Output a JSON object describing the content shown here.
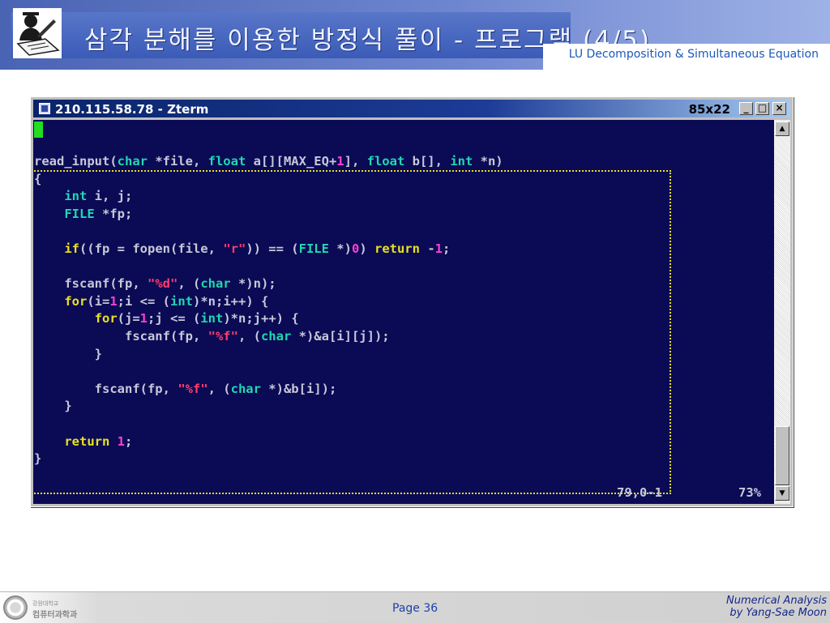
{
  "slide": {
    "title": "삼각 분해를 이용한 방정식 풀이 - 프로그램 (4/5)",
    "subtitle": "LU Decomposition & Simultaneous Equation"
  },
  "terminal": {
    "title": "210.115.58.78 - Zterm",
    "size_label": "85x22",
    "min_glyph": "_",
    "max_glyph": "□",
    "close_glyph": "×",
    "status_position": "79,0-1",
    "status_percent": "73%",
    "scroll_up": "▲",
    "scroll_down": "▼",
    "code_lines": [
      [
        [
          "read_input(",
          ""
        ],
        [
          "char",
          "ty"
        ],
        [
          " *file, ",
          ""
        ],
        [
          "float",
          "ty"
        ],
        [
          " a[][MAX_EQ+",
          ""
        ],
        [
          "1",
          "num"
        ],
        [
          "], ",
          ""
        ],
        [
          "float",
          "ty"
        ],
        [
          " b[], ",
          ""
        ],
        [
          "int",
          "ty"
        ],
        [
          " *n)",
          ""
        ]
      ],
      [
        [
          "{",
          ""
        ]
      ],
      [
        [
          "    ",
          ""
        ],
        [
          "int",
          "ty"
        ],
        [
          " i, j;",
          ""
        ]
      ],
      [
        [
          "    ",
          ""
        ],
        [
          "FILE",
          "ty"
        ],
        [
          " *fp;",
          ""
        ]
      ],
      [
        [
          "",
          ""
        ]
      ],
      [
        [
          "    ",
          ""
        ],
        [
          "if",
          "kw"
        ],
        [
          "((fp = fopen(file, ",
          ""
        ],
        [
          "\"r\"",
          "str"
        ],
        [
          ")) == (",
          ""
        ],
        [
          "FILE",
          "ty"
        ],
        [
          " *)",
          ""
        ],
        [
          "0",
          "num"
        ],
        [
          ") ",
          ""
        ],
        [
          "return",
          "kw"
        ],
        [
          " -",
          ""
        ],
        [
          "1",
          "num"
        ],
        [
          ";",
          ""
        ]
      ],
      [
        [
          "",
          ""
        ]
      ],
      [
        [
          "    fscanf(fp, ",
          ""
        ],
        [
          "\"%d\"",
          "str"
        ],
        [
          ", (",
          ""
        ],
        [
          "char",
          "ty"
        ],
        [
          " *)n);",
          ""
        ]
      ],
      [
        [
          "    ",
          ""
        ],
        [
          "for",
          "kw"
        ],
        [
          "(i=",
          ""
        ],
        [
          "1",
          "num"
        ],
        [
          ";i <= (",
          ""
        ],
        [
          "int",
          "ty"
        ],
        [
          ")*n;i++) {",
          ""
        ]
      ],
      [
        [
          "        ",
          ""
        ],
        [
          "for",
          "kw"
        ],
        [
          "(j=",
          ""
        ],
        [
          "1",
          "num"
        ],
        [
          ";j <= (",
          ""
        ],
        [
          "int",
          "ty"
        ],
        [
          ")*n;j++) {",
          ""
        ]
      ],
      [
        [
          "            fscanf(fp, ",
          ""
        ],
        [
          "\"%f\"",
          "str"
        ],
        [
          ", (",
          ""
        ],
        [
          "char",
          "ty"
        ],
        [
          " *)&a[i][j]);",
          ""
        ]
      ],
      [
        [
          "        }",
          ""
        ]
      ],
      [
        [
          "",
          ""
        ]
      ],
      [
        [
          "        fscanf(fp, ",
          ""
        ],
        [
          "\"%f\"",
          "str"
        ],
        [
          ", (",
          ""
        ],
        [
          "char",
          "ty"
        ],
        [
          " *)&b[i]);",
          ""
        ]
      ],
      [
        [
          "    }",
          ""
        ]
      ],
      [
        [
          "",
          ""
        ]
      ],
      [
        [
          "    ",
          ""
        ],
        [
          "return",
          "kw"
        ],
        [
          " ",
          ""
        ],
        [
          "1",
          "num"
        ],
        [
          ";",
          ""
        ]
      ],
      [
        [
          "}",
          ""
        ]
      ]
    ]
  },
  "footer": {
    "university_small": "강원대학교",
    "department": "컴퓨터과학과",
    "page_label": "Page 36",
    "course_line1": "Numerical Analysis",
    "course_line2": "by Yang-Sae Moon"
  },
  "colors": {
    "terminal_background": "#0a0a55",
    "keyword": "#e8e020",
    "type": "#20d8b0",
    "number": "#ff40d0",
    "string": "#ff3c6c",
    "cursor": "#22dd22",
    "selection_border": "#e6e020"
  },
  "icons": [
    "professor-logo-icon",
    "terminal-app-icon",
    "university-seal-icon"
  ]
}
